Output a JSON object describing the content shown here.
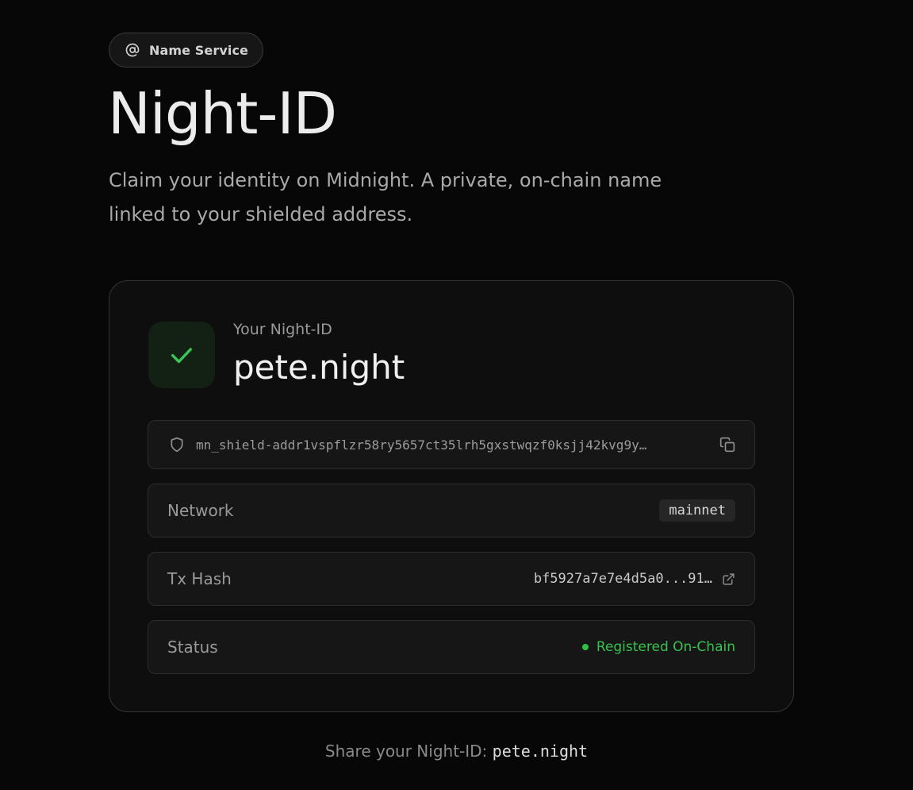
{
  "header": {
    "badge_label": "Name Service",
    "badge_icon": "at-sign-icon",
    "title": "Night-ID",
    "subtitle": "Claim your identity on Midnight. A private, on-chain name linked to your shielded address."
  },
  "card": {
    "check_icon": "check-icon",
    "id_label": "Your Night-ID",
    "id_name": "pete.night",
    "address": {
      "icon": "shield-icon",
      "value": "mn_shield-addr1vspflzr58ry5657ct35lrh5gxstwqzf0ksjj42kvg9y…",
      "copy_icon": "copy-icon"
    },
    "network": {
      "label": "Network",
      "value": "mainnet"
    },
    "tx_hash": {
      "label": "Tx Hash",
      "value": "bf5927a7e7e4d5a0...91…",
      "link_icon": "external-link-icon"
    },
    "status": {
      "label": "Status",
      "value": "Registered On-Chain",
      "color": "#37c24f"
    }
  },
  "footer": {
    "share_prefix": "Share your Night-ID:",
    "share_name": "pete.night"
  },
  "colors": {
    "background": "#070707",
    "accent_green": "#37c24f"
  }
}
